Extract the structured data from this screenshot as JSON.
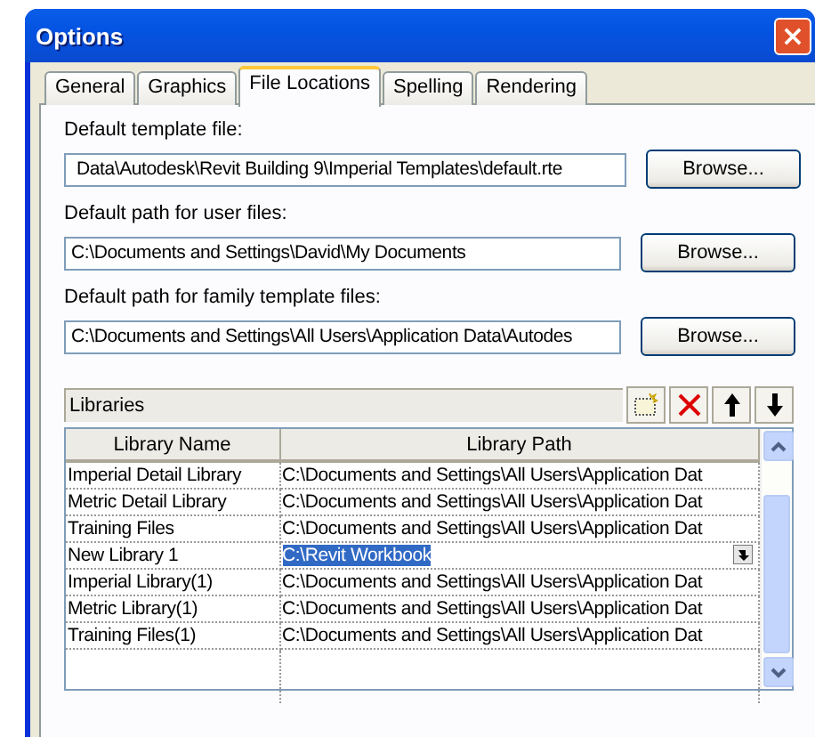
{
  "window": {
    "title": "Options"
  },
  "tabs": [
    {
      "label": "General",
      "selected": false
    },
    {
      "label": "Graphics",
      "selected": false
    },
    {
      "label": "File Locations",
      "selected": true
    },
    {
      "label": "Spelling",
      "selected": false
    },
    {
      "label": "Rendering",
      "selected": false
    }
  ],
  "fields": [
    {
      "label": "Default template file:",
      "value": "Data\\Autodesk\\Revit Building 9\\Imperial Templates\\default.rte",
      "button": "Browse..."
    },
    {
      "label": "Default path for user files:",
      "value": "C:\\Documents and Settings\\David\\My Documents",
      "button": "Browse..."
    },
    {
      "label": "Default path for family template files:",
      "value": "C:\\Documents and Settings\\All Users\\Application Data\\Autodes",
      "button": "Browse..."
    }
  ],
  "libraries": {
    "label": "Libraries",
    "columns": [
      "Library Name",
      "Library Path"
    ],
    "rows": [
      {
        "name": "Imperial Detail Library",
        "path": "C:\\Documents and Settings\\All Users\\Application Dat",
        "selected": false
      },
      {
        "name": "Metric Detail Library",
        "path": "C:\\Documents and Settings\\All Users\\Application Dat",
        "selected": false
      },
      {
        "name": "Training Files",
        "path": "C:\\Documents and Settings\\All Users\\Application Dat",
        "selected": false
      },
      {
        "name": "New Library 1",
        "path": "C:\\Revit Workbook",
        "selected": true
      },
      {
        "name": "Imperial Library(1)",
        "path": "C:\\Documents and Settings\\All Users\\Application Dat",
        "selected": false
      },
      {
        "name": "Metric Library(1)",
        "path": "C:\\Documents and Settings\\All Users\\Application Dat",
        "selected": false
      },
      {
        "name": "Training Files(1)",
        "path": "C:\\Documents and Settings\\All Users\\Application Dat",
        "selected": false
      }
    ]
  }
}
